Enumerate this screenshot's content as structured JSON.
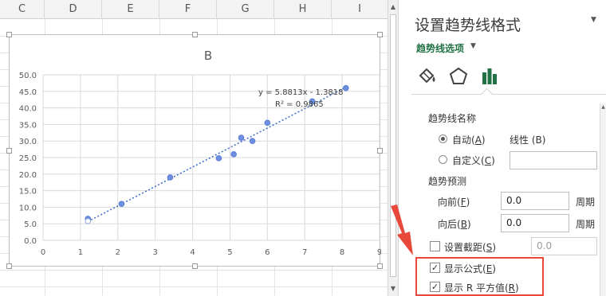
{
  "columns": [
    "C",
    "D",
    "E",
    "F",
    "G",
    "H",
    "I"
  ],
  "chart_data": {
    "type": "scatter",
    "title": "B",
    "xlim": [
      0,
      9
    ],
    "ylim": [
      0,
      50
    ],
    "x_ticks": [
      "0",
      "1",
      "2",
      "3",
      "4",
      "5",
      "6",
      "7",
      "8",
      "9"
    ],
    "y_ticks": [
      "0.0",
      "5.0",
      "10.0",
      "15.0",
      "20.0",
      "25.0",
      "30.0",
      "35.0",
      "40.0",
      "45.0",
      "50.0"
    ],
    "grid": true,
    "series": [
      {
        "x": [
          1.2,
          1.2,
          2.1,
          3.4,
          4.7,
          5.1,
          5.3,
          5.6,
          6.0,
          7.2,
          8.1
        ],
        "y": [
          6.5,
          5.8,
          11.0,
          19.0,
          24.8,
          26.0,
          31.0,
          30.0,
          35.5,
          42.0,
          46.0
        ],
        "color": "#6e8fe0"
      }
    ],
    "trendline": {
      "slope": 5.8813,
      "intercept": -1.3818,
      "x_range": [
        1.2,
        8.1
      ],
      "color": "#4472c4",
      "equation": "y = 5.8813x - 1.3818",
      "r_squared": "R² = 0.9865"
    }
  },
  "pane": {
    "title": "设置趋势线格式",
    "close": "▼",
    "subtitle": "趋势线选项",
    "subtitle_arrow": "▼",
    "tabs": [
      "fill-line-icon",
      "effects-pentagon-icon",
      "options-bar-chart-icon"
    ],
    "trendline_name_label": "趋势线名称",
    "auto_label": "自动",
    "auto_key": "A",
    "auto_value": "线性 (B)",
    "custom_label": "自定义",
    "custom_key": "C",
    "custom_value": "",
    "forecast_label": "趋势预测",
    "forward_label": "向前",
    "forward_key": "F",
    "forward_value": "0.0",
    "forward_unit": "周期",
    "backward_label": "向后",
    "backward_key": "B",
    "backward_value": "0.0",
    "backward_unit": "周期",
    "intercept_label": "设置截距",
    "intercept_key": "S",
    "intercept_value": "0.0",
    "show_equation_label": "显示公式",
    "show_equation_key": "E",
    "show_r2_label": "显示 R 平方值",
    "show_r2_key": "R"
  },
  "state": {
    "auto_selected": true,
    "custom_selected": false,
    "set_intercept": false,
    "show_equation": true,
    "show_r2": true
  },
  "colors": {
    "accent_green": "#217346",
    "annotation_red": "#e8483a",
    "point_color": "#6e8fe0",
    "trendline_color": "#4472c4"
  }
}
